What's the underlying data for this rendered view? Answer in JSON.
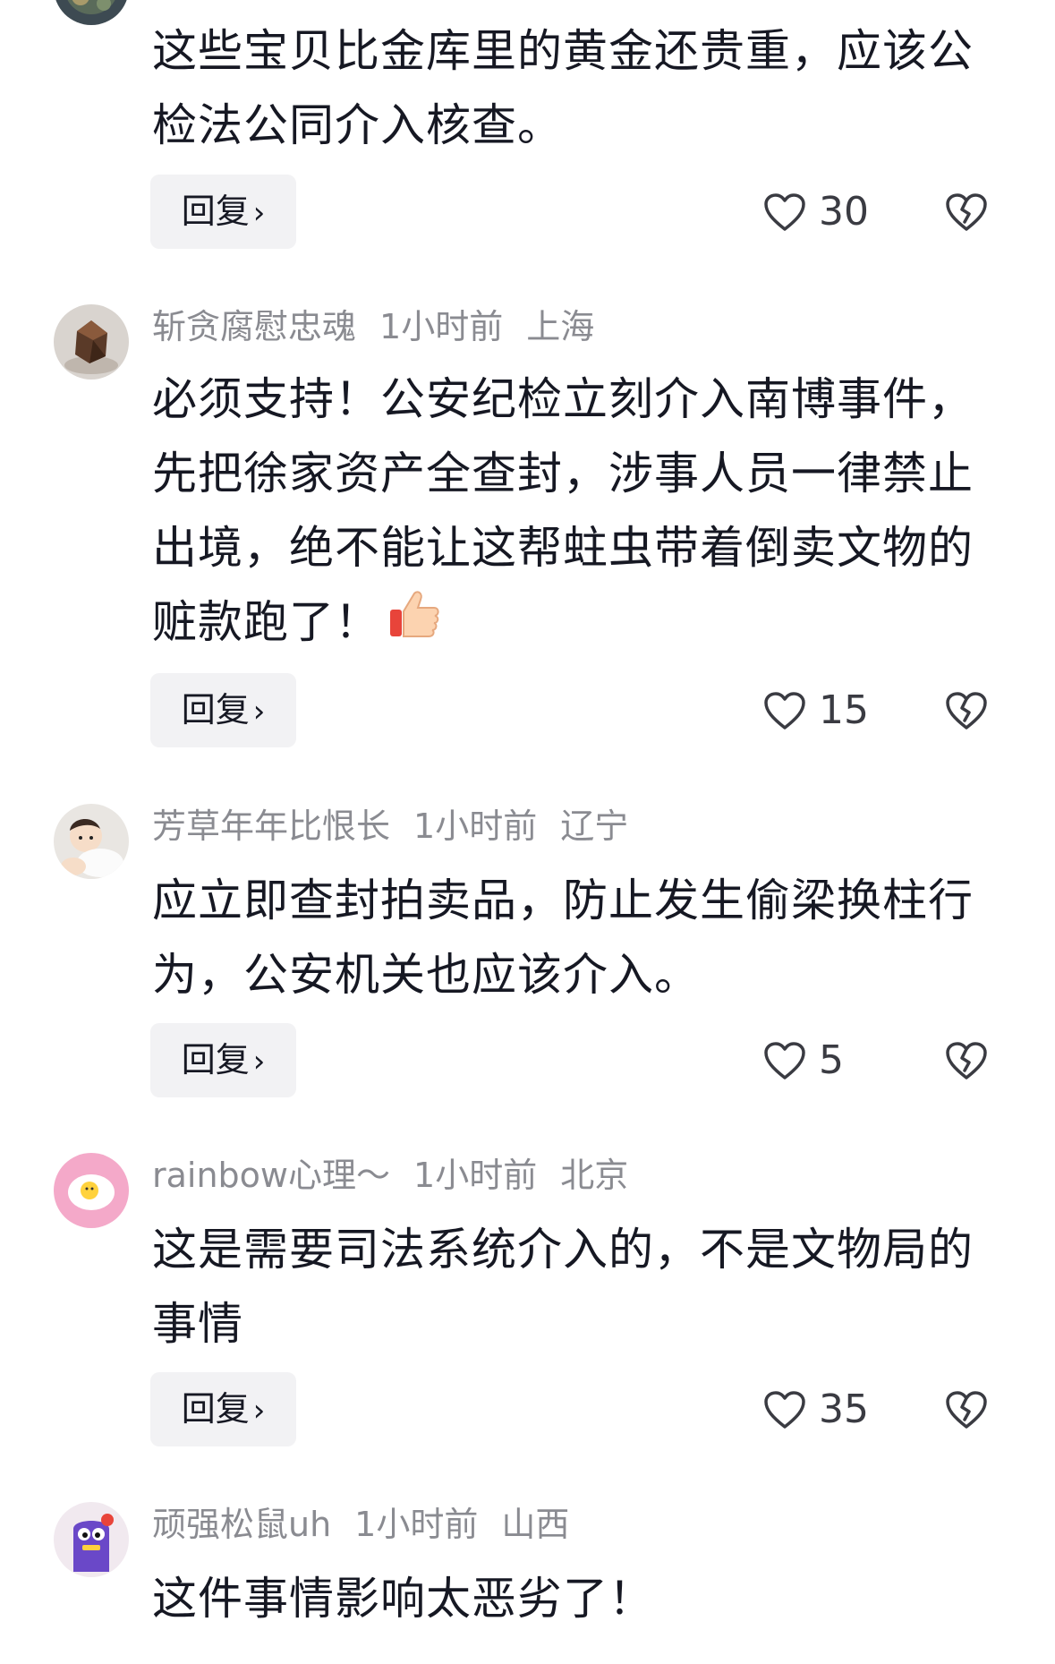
{
  "comments": [
    {
      "username": "",
      "time": "",
      "location": "",
      "text": "这些宝贝比金库里的黄金还贵重，应该公检法公同介入核查。",
      "reply_label": "回复",
      "reply_chevron": "›",
      "likes": "30",
      "avatar_icon": "globe-avatar"
    },
    {
      "username": "斩贪腐慰忠魂",
      "time": "1小时前",
      "location": "上海",
      "text": "必须支持！公安纪检立刻介入南博事件，先把徐家资产全查封，涉事人员一律禁止出境，绝不能让这帮蛀虫带着倒卖文物的赃款跑了！",
      "reply_label": "回复",
      "reply_chevron": "›",
      "likes": "15",
      "avatar_icon": "sculpture-avatar",
      "emoji": "thumbs-up-icon"
    },
    {
      "username": "芳草年年比恨长",
      "time": "1小时前",
      "location": "辽宁",
      "text": "应立即查封拍卖品，防止发生偷梁换柱行为，公安机关也应该介入。",
      "reply_label": "回复",
      "reply_chevron": "›",
      "likes": "5",
      "avatar_icon": "baby-avatar"
    },
    {
      "username": "rainbow心理～",
      "time": "1小时前",
      "location": "北京",
      "text": "这是需要司法系统介入的，不是文物局的事情",
      "reply_label": "回复",
      "reply_chevron": "›",
      "likes": "35",
      "avatar_icon": "egg-avatar"
    },
    {
      "username": "顽强松鼠uh",
      "time": "1小时前",
      "location": "山西",
      "text": "这件事情影响太恶劣了！",
      "avatar_icon": "cartoon-avatar"
    }
  ],
  "colors": {
    "text": "#161823",
    "meta": "#8a8b91",
    "reply_bg": "#f2f2f4",
    "icon": "#3a3b42"
  }
}
